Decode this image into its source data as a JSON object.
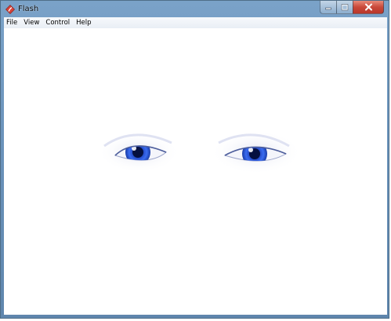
{
  "window": {
    "title": "Flash",
    "app_icon": "flash-player-icon",
    "controls": {
      "minimize_icon": "minimize-icon",
      "maximize_icon": "maximize-icon",
      "close_icon": "close-icon"
    }
  },
  "menu": {
    "items": [
      {
        "label": "File"
      },
      {
        "label": "View"
      },
      {
        "label": "Control"
      },
      {
        "label": "Help"
      }
    ]
  },
  "content": {
    "image": "two-blue-eyes-illustration",
    "colors": {
      "iris": "#2c55d6",
      "iris_dark": "#0b1f7a",
      "background": "#ffffff"
    }
  },
  "colors": {
    "title_bar": "#6b93bb",
    "menu_bar": "#eef2f7",
    "close_button": "#c9493a"
  }
}
